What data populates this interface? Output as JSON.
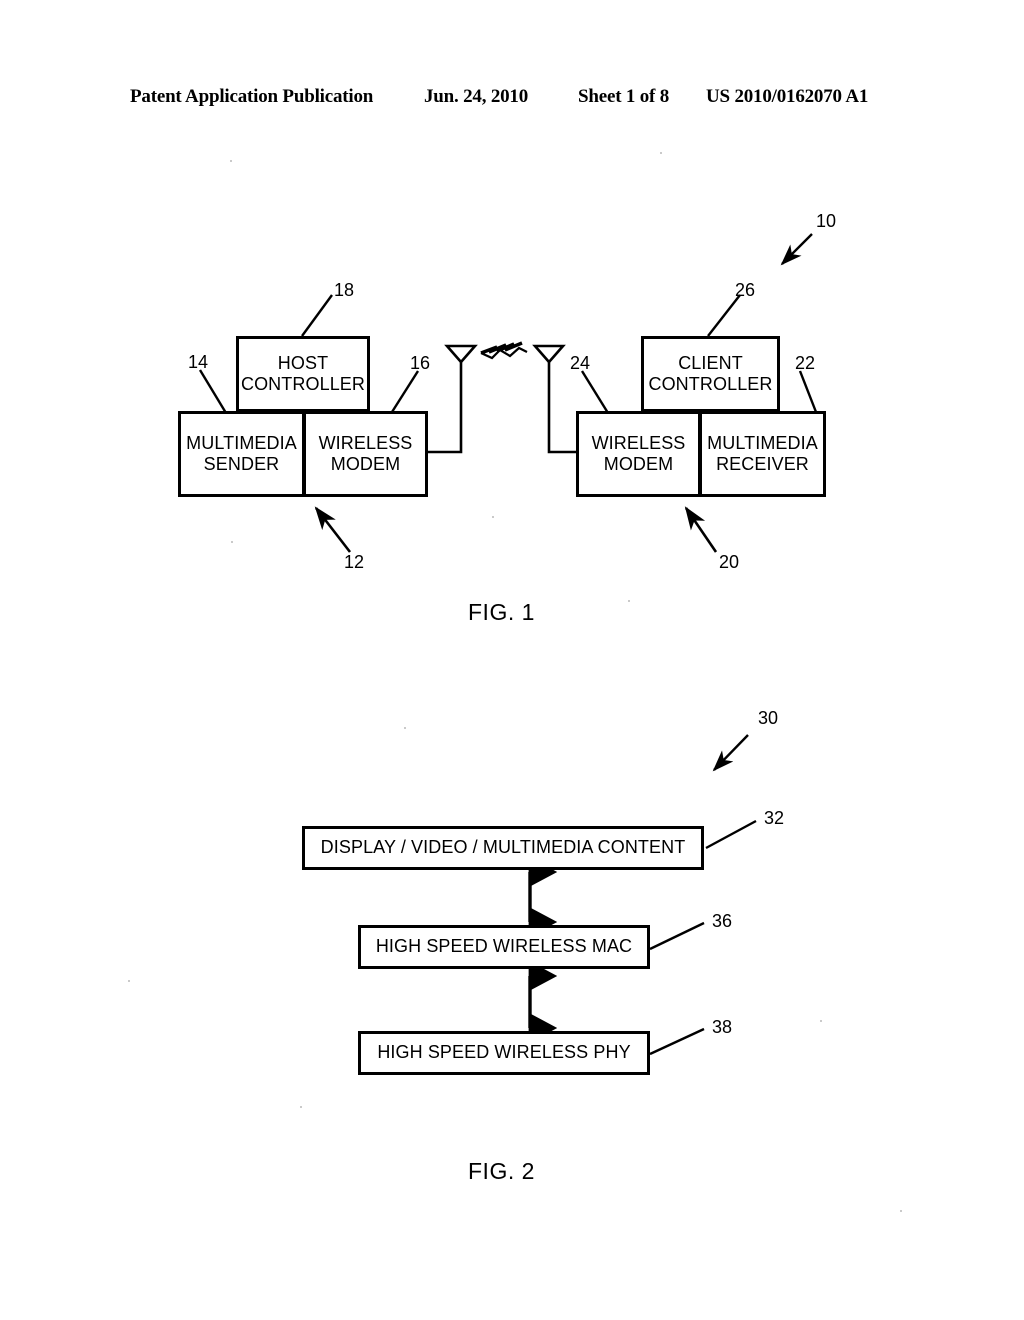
{
  "header": {
    "publication": "Patent Application Publication",
    "date": "Jun. 24, 2010",
    "sheet": "Sheet 1 of 8",
    "patent_number": "US 2010/0162070 A1"
  },
  "figure1": {
    "caption": "FIG. 1",
    "system_ref": "10",
    "boxes": {
      "host_controller": {
        "line1": "HOST",
        "line2": "CONTROLLER",
        "ref": "18"
      },
      "multimedia_sender": {
        "line1": "MULTIMEDIA",
        "line2": "SENDER",
        "ref": "14"
      },
      "wireless_modem_host": {
        "line1": "WIRELESS",
        "line2": "MODEM",
        "ref": "16"
      },
      "client_controller": {
        "line1": "CLIENT",
        "line2": "CONTROLLER",
        "ref": "26"
      },
      "wireless_modem_client": {
        "line1": "WIRELESS",
        "line2": "MODEM",
        "ref": "24"
      },
      "multimedia_receiver": {
        "line1": "MULTIMEDIA",
        "line2": "RECEIVER",
        "ref": "22"
      }
    },
    "group_refs": {
      "sender_side": "12",
      "receiver_side": "20"
    },
    "link": {
      "name": "wireless-rf-link",
      "tx_antenna": "transmit-antenna",
      "rx_antenna": "receive-antenna"
    }
  },
  "figure2": {
    "caption": "FIG. 2",
    "stack_ref": "30",
    "layers": [
      {
        "label": "DISPLAY / VIDEO / MULTIMEDIA CONTENT",
        "ref": "32"
      },
      {
        "label": "HIGH SPEED WIRELESS MAC",
        "ref": "36"
      },
      {
        "label": "HIGH SPEED WIRELESS PHY",
        "ref": "38"
      }
    ]
  },
  "colors": {
    "ink": "#000000",
    "paper": "#ffffff"
  }
}
